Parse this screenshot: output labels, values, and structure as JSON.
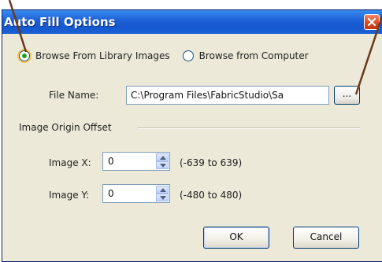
{
  "window": {
    "title": "Auto Fill Options"
  },
  "source": {
    "option_library": "Browse From Library Images",
    "option_computer": "Browse from Computer",
    "selected": "library"
  },
  "file": {
    "label": "File Name:",
    "value": "C:\\Program Files\\FabricStudio\\Sa",
    "browse_label": "..."
  },
  "offset_group": {
    "title": "Image Origin Offset",
    "x_label": "Image X:",
    "x_value": "0",
    "x_range": "(-639 to 639)",
    "y_label": "Image Y:",
    "y_value": "0",
    "y_range": "(-480 to 480)"
  },
  "buttons": {
    "ok": "OK",
    "cancel": "Cancel"
  },
  "colors": {
    "titlebar": "#1f63d8",
    "callout_line": "#6b3a1f",
    "dialog_bg": "#ece9d8"
  },
  "icons": {
    "close": "close-icon",
    "spin_up": "chevron-up-icon",
    "spin_down": "chevron-down-icon"
  }
}
